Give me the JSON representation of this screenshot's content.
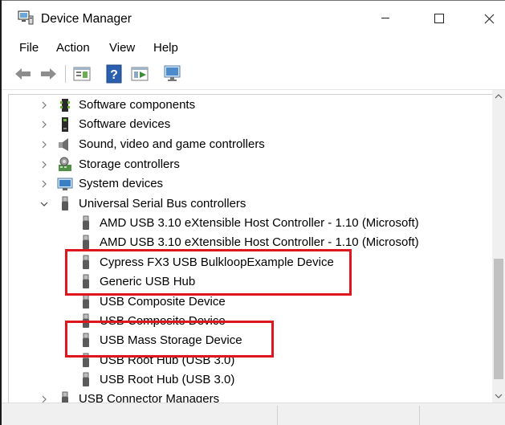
{
  "window": {
    "title": "Device Manager"
  },
  "menu": [
    "File",
    "Action",
    "View",
    "Help"
  ],
  "toolbar": {
    "buttons": [
      {
        "icon": "back-arrow-icon"
      },
      {
        "icon": "forward-arrow-icon"
      },
      {
        "icon": "properties-icon"
      },
      {
        "icon": "help-icon"
      },
      {
        "icon": "update-driver-icon"
      },
      {
        "icon": "scan-hardware-icon"
      }
    ]
  },
  "tree": {
    "categories": [
      {
        "label": "Software components",
        "expanded": false,
        "icon": "software-components-icon"
      },
      {
        "label": "Software devices",
        "expanded": false,
        "icon": "software-devices-icon"
      },
      {
        "label": "Sound, video and game controllers",
        "expanded": false,
        "icon": "speaker-icon"
      },
      {
        "label": "Storage controllers",
        "expanded": false,
        "icon": "storage-controller-icon"
      },
      {
        "label": "System devices",
        "expanded": false,
        "icon": "system-devices-icon"
      },
      {
        "label": "Universal Serial Bus controllers",
        "expanded": true,
        "icon": "usb-icon"
      }
    ],
    "usb_devices": [
      "AMD USB 3.10 eXtensible Host Controller - 1.10 (Microsoft)",
      "AMD USB 3.10 eXtensible Host Controller - 1.10 (Microsoft)",
      "Cypress FX3 USB BulkloopExample Device",
      "Generic USB Hub",
      "USB Composite Device",
      "USB Composite Device",
      "USB Mass Storage Device",
      "USB Root Hub (USB 3.0)",
      "USB Root Hub (USB 3.0)"
    ],
    "after": [
      {
        "label": "USB Connector Managers",
        "expanded": false,
        "icon": "usb-icon"
      }
    ]
  },
  "annotations": {
    "highlight_color": "#e0161e"
  }
}
